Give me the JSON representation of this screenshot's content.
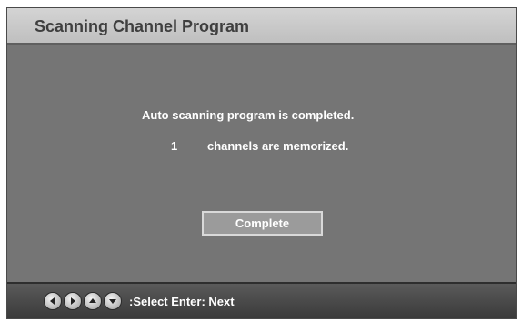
{
  "header": {
    "title": "Scanning Channel Program"
  },
  "main": {
    "status_message": "Auto scanning program is completed.",
    "channel_count": "1",
    "channels_text": "channels are memorized.",
    "complete_button_label": "Complete"
  },
  "footer": {
    "nav_icons": [
      "arrow-left-icon",
      "arrow-right-icon",
      "arrow-up-icon",
      "arrow-down-icon"
    ],
    "hint_text": ":Select Enter: Next"
  }
}
